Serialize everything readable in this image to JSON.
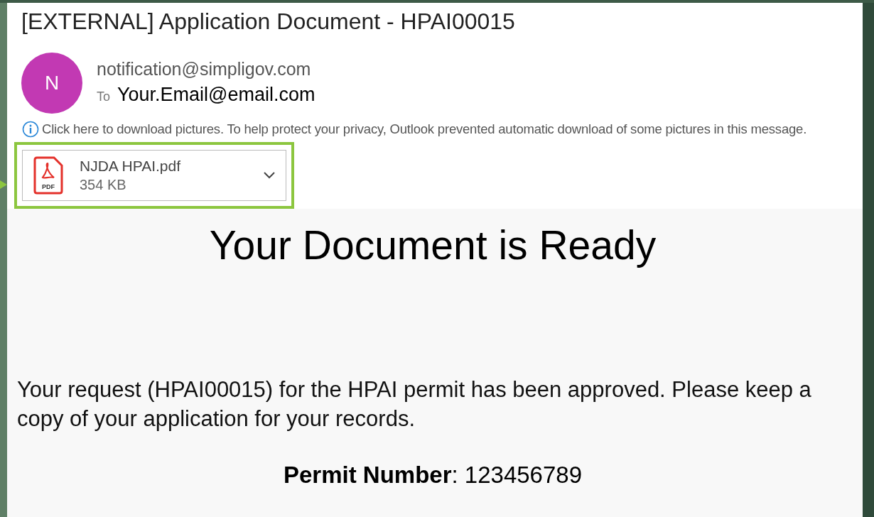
{
  "email": {
    "subject": "[EXTERNAL] Application Document - HPAI00015",
    "avatar_initial": "N",
    "sender": "notification@simpligov.com",
    "to_label": "To",
    "recipient": "Your.Email@email.com",
    "info_bar": "Click here to download pictures. To help protect your privacy, Outlook prevented automatic download of some pictures in this message.",
    "attachment": {
      "name": "NJDA HPAI.pdf",
      "size": "354 KB",
      "file_type": "PDF",
      "highlighted": true
    }
  },
  "body": {
    "heading": "Your Document is Ready",
    "message": "Your request (HPAI00015) for the HPAI permit has been approved. Please keep a copy of your application for your records.",
    "permit_line": "**Permit Number**: 123456789"
  }
}
